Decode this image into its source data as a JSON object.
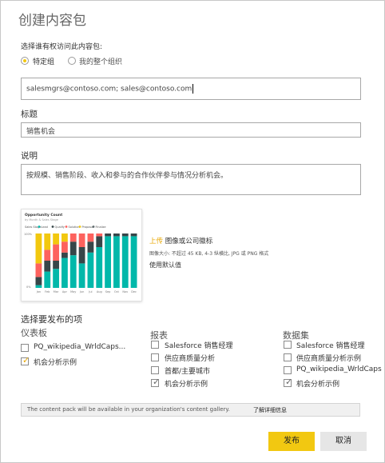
{
  "dialog": {
    "title": "创建内容包",
    "access_prompt": "选择谁有权访问此内容包:",
    "radio_specific": "特定组",
    "radio_org": "我的整个组织",
    "recipients_value": "salesmgrs@contoso.com;  sales@contoso.com",
    "title_label": "标题",
    "title_value": "销售机会",
    "desc_label": "说明",
    "desc_value": "按规模、销售阶段、收入和参与的合作伙伴参与情况分析机会。",
    "upload_link": "上传",
    "upload_rest": " 图像或公司徽标",
    "upload_hint": "图像大小: 不超过 45 KB, 4-3 纵横比, JPG 或 PNG 格式",
    "use_default": "使用默认值",
    "publish_heading": "选择要发布的项",
    "columns": [
      {
        "heading": "仪表板",
        "items": [
          {
            "label": "PQ_wikipedia_WrldCaps...",
            "checked": false
          },
          {
            "label": "机会分析示例",
            "checked": true
          }
        ]
      },
      {
        "heading": "报表",
        "items": [
          {
            "label": "Salesforce 销售经理",
            "checked": false
          },
          {
            "label": "供应商质量分析",
            "checked": false
          },
          {
            "label": "首都/主要城市",
            "checked": false
          },
          {
            "label": "机会分析示例",
            "checked": true
          }
        ]
      },
      {
        "heading": "数据集",
        "items": [
          {
            "label": "Salesforce 销售经理",
            "checked": false
          },
          {
            "label": "供应商质量分析示例",
            "checked": false
          },
          {
            "label": "PQ_wikipedia_WrldCaps",
            "checked": false
          },
          {
            "label": "机会分析示例",
            "checked": true
          }
        ]
      }
    ],
    "info_text": "The content pack will be available in your organization's content gallery.",
    "info_link": "了解详细信息",
    "publish_button": "发布",
    "cancel_button": "取消"
  },
  "thumbnail": {
    "chart_title": "Opportunity Count",
    "chart_subtitle": "by Month & Sales Stage",
    "legend_title": "Sales Stage",
    "legend": [
      {
        "name": "Lead",
        "color": "#01b8aa"
      },
      {
        "name": "Qualify",
        "color": "#374649"
      },
      {
        "name": "Solution",
        "color": "#fd625e"
      },
      {
        "name": "Proposal",
        "color": "#f2c80f"
      },
      {
        "name": "Finalize",
        "color": "#5f6b6d"
      }
    ],
    "y_ticks": [
      "100%",
      "0%"
    ]
  },
  "chart_data": {
    "type": "bar",
    "stacked": true,
    "categories": [
      "Jan",
      "Feb",
      "Mar",
      "Apr",
      "May",
      "Jun",
      "Jul",
      "Aug",
      "Sep",
      "Oct",
      "Nov",
      "Dec"
    ],
    "ylim": [
      0,
      100
    ],
    "series": [
      {
        "name": "Lead",
        "color": "#01b8aa",
        "values": [
          5,
          30,
          35,
          55,
          60,
          45,
          65,
          75,
          95,
          95,
          95,
          95
        ]
      },
      {
        "name": "Qualify",
        "color": "#374649",
        "values": [
          15,
          20,
          15,
          10,
          25,
          30,
          20,
          20,
          5,
          5,
          5,
          5
        ]
      },
      {
        "name": "Solution",
        "color": "#fd625e",
        "values": [
          25,
          20,
          30,
          20,
          15,
          25,
          15,
          5,
          0,
          0,
          0,
          0
        ]
      },
      {
        "name": "Proposal",
        "color": "#f2c80f",
        "values": [
          55,
          30,
          20,
          15,
          0,
          0,
          0,
          0,
          0,
          0,
          0,
          0
        ]
      },
      {
        "name": "Finalize",
        "color": "#5f6b6d",
        "values": [
          0,
          0,
          0,
          0,
          0,
          0,
          0,
          0,
          0,
          0,
          0,
          0
        ]
      }
    ]
  }
}
